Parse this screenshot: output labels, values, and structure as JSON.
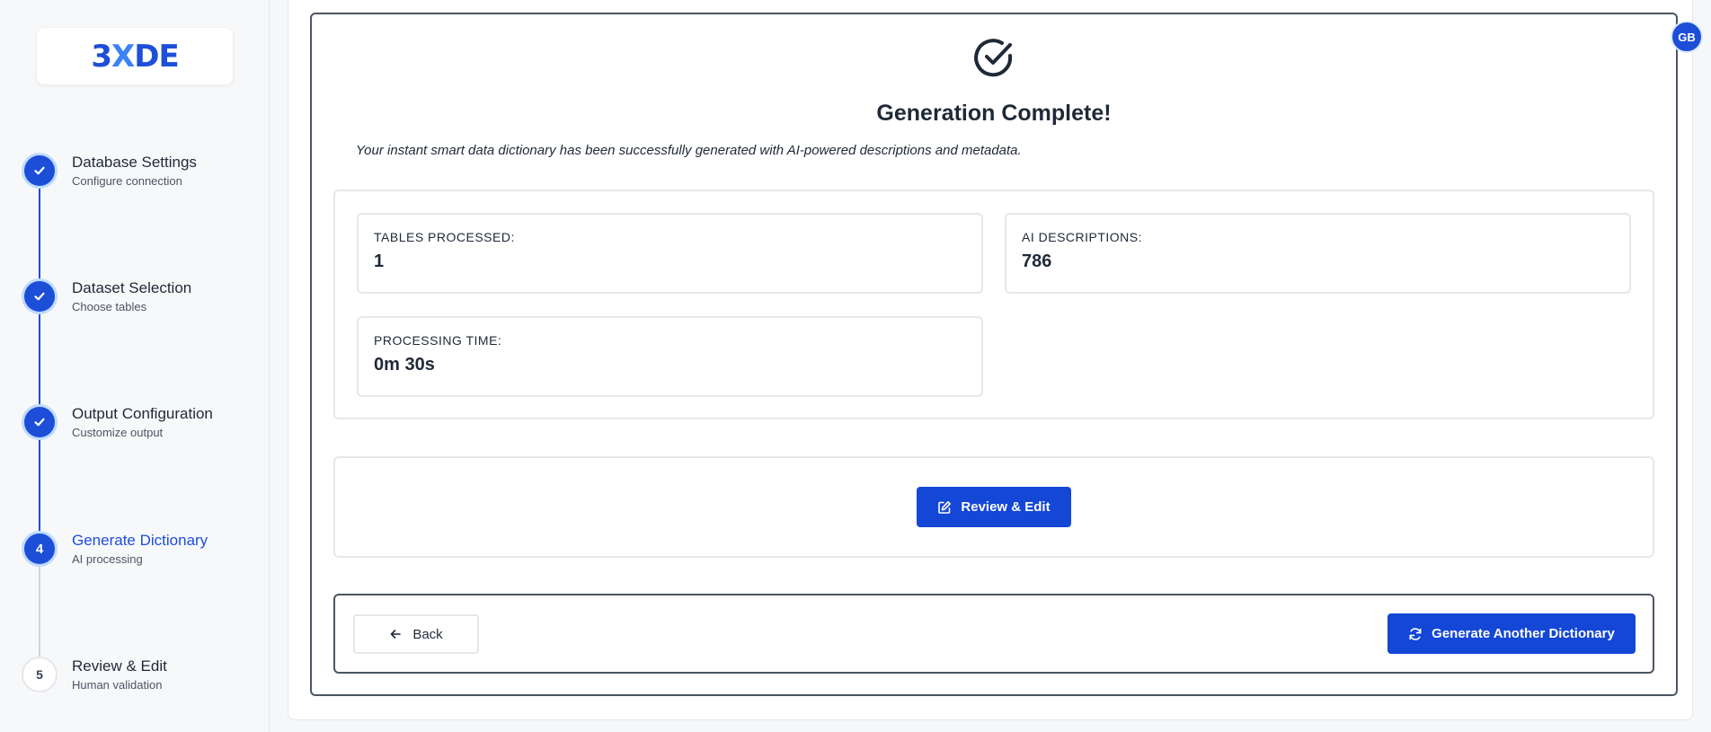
{
  "brand": {
    "logo_left": "3",
    "logo_x": "X",
    "logo_right": "DE"
  },
  "user": {
    "initials": "GB"
  },
  "steps": [
    {
      "number": "1",
      "title": "Database Settings",
      "subtitle": "Configure connection",
      "state": "complete"
    },
    {
      "number": "2",
      "title": "Dataset Selection",
      "subtitle": "Choose tables",
      "state": "complete"
    },
    {
      "number": "3",
      "title": "Output Configuration",
      "subtitle": "Customize output",
      "state": "complete"
    },
    {
      "number": "4",
      "title": "Generate Dictionary",
      "subtitle": "AI processing",
      "state": "active"
    },
    {
      "number": "5",
      "title": "Review & Edit",
      "subtitle": "Human validation",
      "state": "pending"
    }
  ],
  "result": {
    "title": "Generation Complete!",
    "message": "Your instant smart data dictionary has been successfully generated with AI-powered descriptions and metadata."
  },
  "stats": {
    "tables_label": "TABLES PROCESSED:",
    "tables_value": "1",
    "ai_label": "AI DESCRIPTIONS:",
    "ai_value": "786",
    "time_label": "PROCESSING TIME:",
    "time_value": "0m 30s"
  },
  "actions": {
    "review_label": "Review & Edit",
    "back_label": "Back",
    "generate_another_label": "Generate Another Dictionary"
  },
  "colors": {
    "primary": "#1447d6",
    "step_active": "#1d4ed8",
    "text": "#1f2937"
  }
}
